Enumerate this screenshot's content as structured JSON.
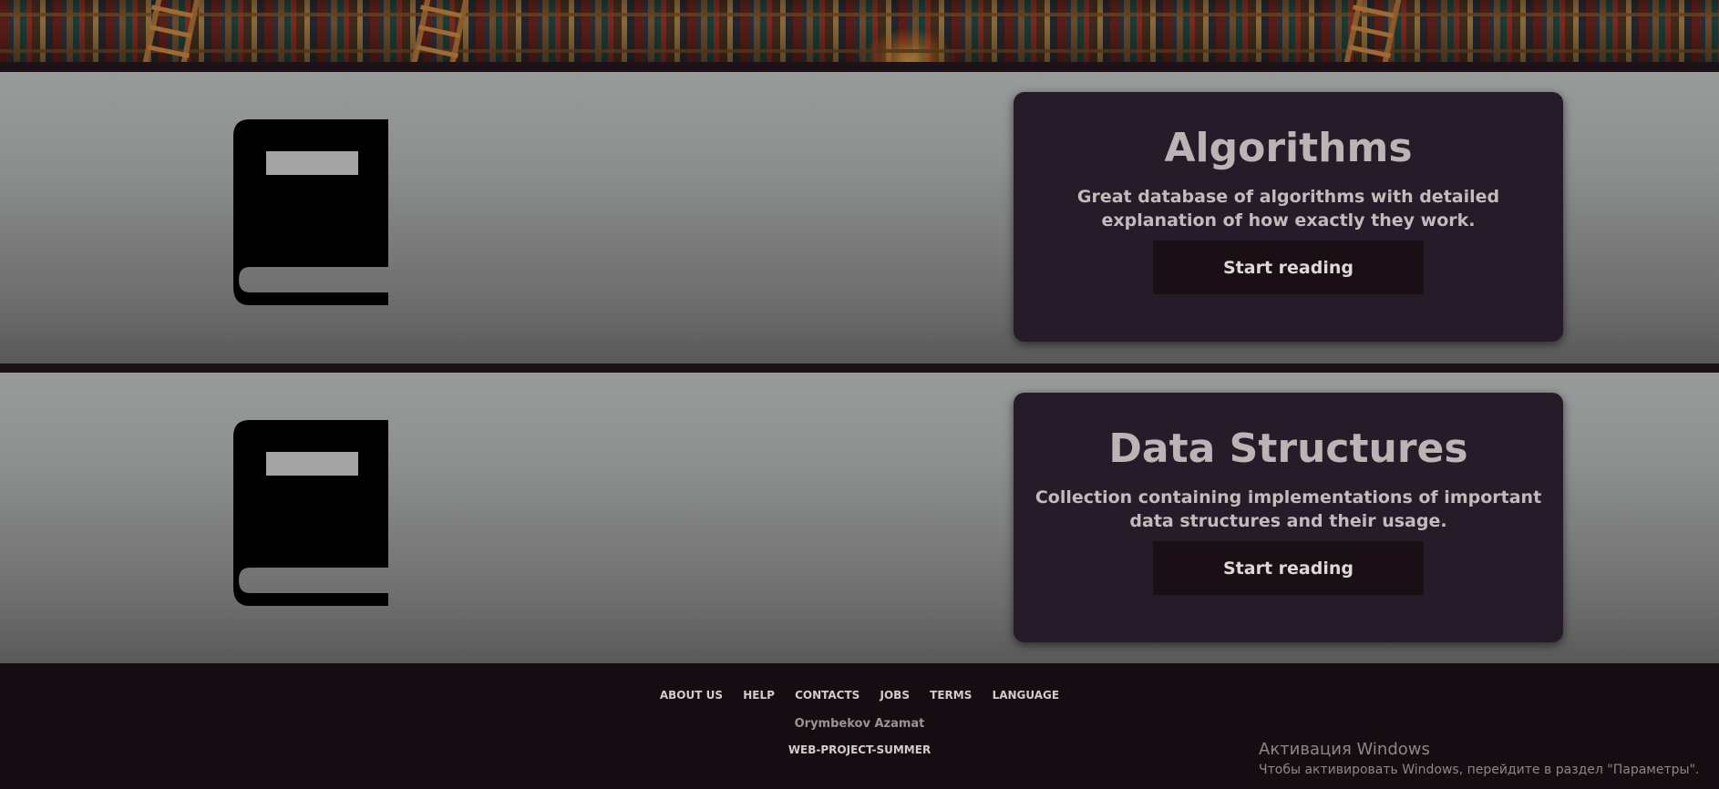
{
  "banner": {
    "icon": "bookshelf-banner-image"
  },
  "sections": [
    {
      "icon": "book-icon",
      "title": "Algorithms",
      "description": "Great database of algorithms with detailed explanation of how exactly they work.",
      "button_label": "Start reading"
    },
    {
      "icon": "book-icon",
      "title": "Data Structures",
      "description": "Collection containing implementations of important data structures and their usage.",
      "button_label": "Start reading"
    }
  ],
  "footer": {
    "nav": [
      "ABOUT US",
      "HELP",
      "CONTACTS",
      "JOBS",
      "TERMS",
      "LANGUAGE"
    ],
    "author": "Orymbekov Azamat",
    "project": "WEB-PROJECT-SUMMER"
  },
  "windows_watermark": {
    "title": "Активация Windows",
    "subtitle": "Чтобы активировать Windows, перейдите в раздел \"Параметры\"."
  },
  "colors": {
    "card_bg": "#261b29",
    "button_bg": "#190f14",
    "page_bg": "#150d12",
    "section_gradient_top": "#979b9a",
    "section_gradient_bottom": "#5a595a"
  }
}
